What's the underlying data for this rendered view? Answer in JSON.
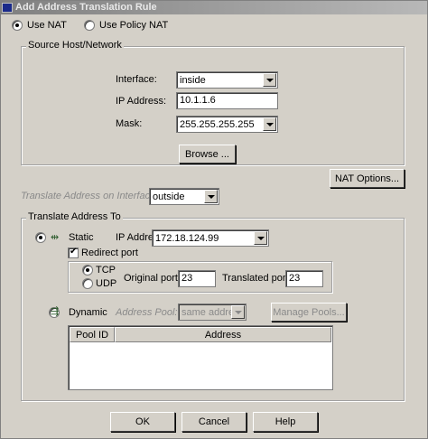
{
  "window": {
    "title": "Add Address Translation Rule"
  },
  "nat_mode": {
    "use_nat": "Use NAT",
    "use_policy_nat": "Use Policy NAT",
    "selected": "use_nat"
  },
  "source": {
    "group_label": "Source Host/Network",
    "interface_label": "Interface:",
    "interface_value": "inside",
    "ip_label": "IP Address:",
    "ip_value": "10.1.1.6",
    "mask_label": "Mask:",
    "mask_value": "255.255.255.255",
    "browse_label": "Browse ..."
  },
  "nat_options_label": "NAT Options...",
  "translate_on_interface": {
    "label": "Translate Address on Interface:",
    "value": "outside"
  },
  "translate_to": {
    "group_label": "Translate Address To",
    "static_label": "Static",
    "static_ip_label": "IP Address:",
    "static_ip_value": "172.18.124.99",
    "redirect_label": "Redirect port",
    "redirect_checked": true,
    "tcp_label": "TCP",
    "udp_label": "UDP",
    "protocol_selected": "tcp",
    "original_port_label": "Original port:",
    "original_port_value": "23",
    "translated_port_label": "Translated port:",
    "translated_port_value": "23",
    "dynamic_label": "Dynamic",
    "address_pool_label": "Address Pool:",
    "address_pool_value": "same address",
    "manage_pools_label": "Manage Pools...",
    "table_headers": [
      "Pool ID",
      "Address"
    ],
    "selected": "static"
  },
  "footer": {
    "ok_label": "OK",
    "cancel_label": "Cancel",
    "help_label": "Help"
  }
}
